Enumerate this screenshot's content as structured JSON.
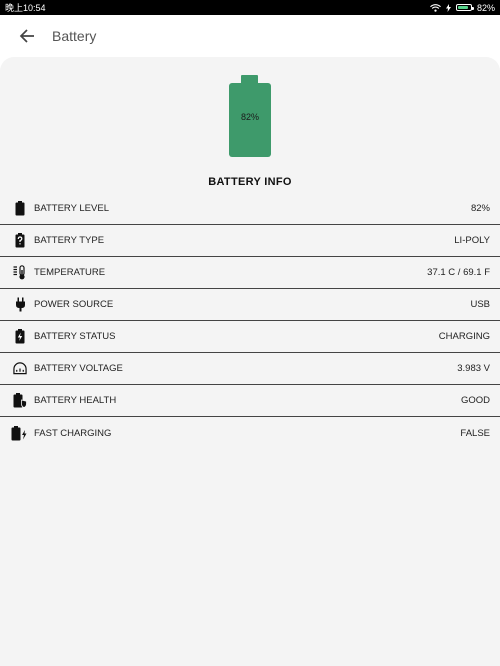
{
  "status_bar": {
    "time": "晚上10:54",
    "battery_percent": "82%",
    "battery_level": 0.82
  },
  "app_bar": {
    "title": "Battery"
  },
  "battery_icon": {
    "percent_label": "82%",
    "color": "#3e9a6b"
  },
  "section_title": "BATTERY INFO",
  "info_rows": [
    {
      "icon": "battery-icon",
      "label": "BATTERY LEVEL",
      "value": "82%"
    },
    {
      "icon": "battery-unknown-icon",
      "label": "BATTERY TYPE",
      "value": "LI-POLY"
    },
    {
      "icon": "thermometer-icon",
      "label": "TEMPERATURE",
      "value": "37.1 C / 69.1 F"
    },
    {
      "icon": "plug-icon",
      "label": "POWER SOURCE",
      "value": "USB"
    },
    {
      "icon": "battery-charging-icon",
      "label": "BATTERY STATUS",
      "value": "CHARGING"
    },
    {
      "icon": "voltage-gauge-icon",
      "label": "BATTERY VOLTAGE",
      "value": "3.983 V"
    },
    {
      "icon": "battery-health-icon",
      "label": "BATTERY HEALTH",
      "value": "GOOD"
    },
    {
      "icon": "fast-charging-icon",
      "label": "FAST CHARGING",
      "value": "FALSE"
    }
  ]
}
